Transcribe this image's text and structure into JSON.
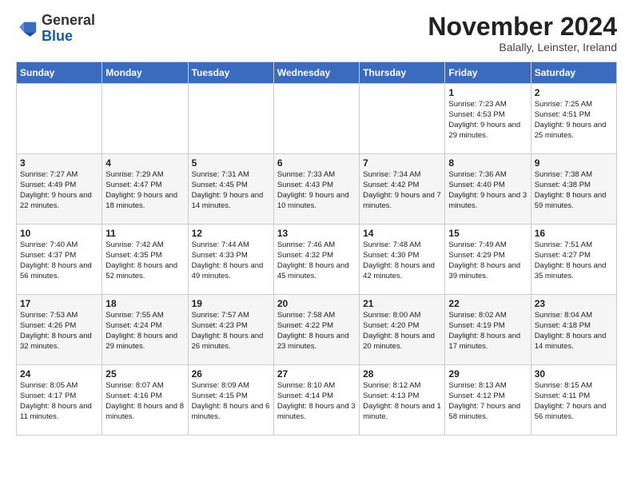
{
  "header": {
    "logo_general": "General",
    "logo_blue": "Blue",
    "month_title": "November 2024",
    "location": "Balally, Leinster, Ireland"
  },
  "days_of_week": [
    "Sunday",
    "Monday",
    "Tuesday",
    "Wednesday",
    "Thursday",
    "Friday",
    "Saturday"
  ],
  "weeks": [
    [
      {
        "day": "",
        "info": ""
      },
      {
        "day": "",
        "info": ""
      },
      {
        "day": "",
        "info": ""
      },
      {
        "day": "",
        "info": ""
      },
      {
        "day": "",
        "info": ""
      },
      {
        "day": "1",
        "info": "Sunrise: 7:23 AM\nSunset: 4:53 PM\nDaylight: 9 hours and 29 minutes."
      },
      {
        "day": "2",
        "info": "Sunrise: 7:25 AM\nSunset: 4:51 PM\nDaylight: 9 hours and 25 minutes."
      }
    ],
    [
      {
        "day": "3",
        "info": "Sunrise: 7:27 AM\nSunset: 4:49 PM\nDaylight: 9 hours and 22 minutes."
      },
      {
        "day": "4",
        "info": "Sunrise: 7:29 AM\nSunset: 4:47 PM\nDaylight: 9 hours and 18 minutes."
      },
      {
        "day": "5",
        "info": "Sunrise: 7:31 AM\nSunset: 4:45 PM\nDaylight: 9 hours and 14 minutes."
      },
      {
        "day": "6",
        "info": "Sunrise: 7:33 AM\nSunset: 4:43 PM\nDaylight: 9 hours and 10 minutes."
      },
      {
        "day": "7",
        "info": "Sunrise: 7:34 AM\nSunset: 4:42 PM\nDaylight: 9 hours and 7 minutes."
      },
      {
        "day": "8",
        "info": "Sunrise: 7:36 AM\nSunset: 4:40 PM\nDaylight: 9 hours and 3 minutes."
      },
      {
        "day": "9",
        "info": "Sunrise: 7:38 AM\nSunset: 4:38 PM\nDaylight: 8 hours and 59 minutes."
      }
    ],
    [
      {
        "day": "10",
        "info": "Sunrise: 7:40 AM\nSunset: 4:37 PM\nDaylight: 8 hours and 56 minutes."
      },
      {
        "day": "11",
        "info": "Sunrise: 7:42 AM\nSunset: 4:35 PM\nDaylight: 8 hours and 52 minutes."
      },
      {
        "day": "12",
        "info": "Sunrise: 7:44 AM\nSunset: 4:33 PM\nDaylight: 8 hours and 49 minutes."
      },
      {
        "day": "13",
        "info": "Sunrise: 7:46 AM\nSunset: 4:32 PM\nDaylight: 8 hours and 45 minutes."
      },
      {
        "day": "14",
        "info": "Sunrise: 7:48 AM\nSunset: 4:30 PM\nDaylight: 8 hours and 42 minutes."
      },
      {
        "day": "15",
        "info": "Sunrise: 7:49 AM\nSunset: 4:29 PM\nDaylight: 8 hours and 39 minutes."
      },
      {
        "day": "16",
        "info": "Sunrise: 7:51 AM\nSunset: 4:27 PM\nDaylight: 8 hours and 35 minutes."
      }
    ],
    [
      {
        "day": "17",
        "info": "Sunrise: 7:53 AM\nSunset: 4:26 PM\nDaylight: 8 hours and 32 minutes."
      },
      {
        "day": "18",
        "info": "Sunrise: 7:55 AM\nSunset: 4:24 PM\nDaylight: 8 hours and 29 minutes."
      },
      {
        "day": "19",
        "info": "Sunrise: 7:57 AM\nSunset: 4:23 PM\nDaylight: 8 hours and 26 minutes."
      },
      {
        "day": "20",
        "info": "Sunrise: 7:58 AM\nSunset: 4:22 PM\nDaylight: 8 hours and 23 minutes."
      },
      {
        "day": "21",
        "info": "Sunrise: 8:00 AM\nSunset: 4:20 PM\nDaylight: 8 hours and 20 minutes."
      },
      {
        "day": "22",
        "info": "Sunrise: 8:02 AM\nSunset: 4:19 PM\nDaylight: 8 hours and 17 minutes."
      },
      {
        "day": "23",
        "info": "Sunrise: 8:04 AM\nSunset: 4:18 PM\nDaylight: 8 hours and 14 minutes."
      }
    ],
    [
      {
        "day": "24",
        "info": "Sunrise: 8:05 AM\nSunset: 4:17 PM\nDaylight: 8 hours and 11 minutes."
      },
      {
        "day": "25",
        "info": "Sunrise: 8:07 AM\nSunset: 4:16 PM\nDaylight: 8 hours and 8 minutes."
      },
      {
        "day": "26",
        "info": "Sunrise: 8:09 AM\nSunset: 4:15 PM\nDaylight: 8 hours and 6 minutes."
      },
      {
        "day": "27",
        "info": "Sunrise: 8:10 AM\nSunset: 4:14 PM\nDaylight: 8 hours and 3 minutes."
      },
      {
        "day": "28",
        "info": "Sunrise: 8:12 AM\nSunset: 4:13 PM\nDaylight: 8 hours and 1 minute."
      },
      {
        "day": "29",
        "info": "Sunrise: 8:13 AM\nSunset: 4:12 PM\nDaylight: 7 hours and 58 minutes."
      },
      {
        "day": "30",
        "info": "Sunrise: 8:15 AM\nSunset: 4:11 PM\nDaylight: 7 hours and 56 minutes."
      }
    ]
  ]
}
